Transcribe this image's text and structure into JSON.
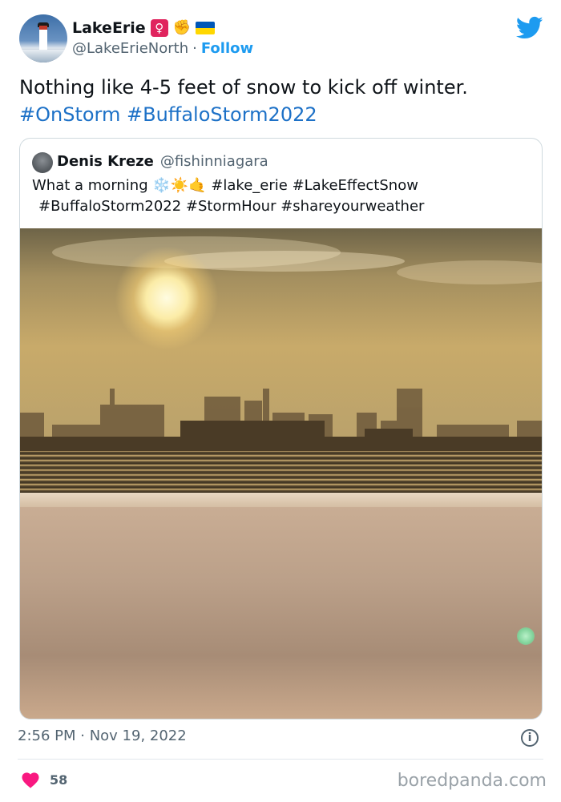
{
  "author": {
    "display_name": "LakeErie",
    "badges": [
      "♀",
      "✊"
    ],
    "handle": "@LakeErieNorth",
    "separator": "·",
    "follow_label": "Follow"
  },
  "tweet": {
    "text": "Nothing like 4-5 feet of snow to kick off winter.",
    "hashtags": [
      "#OnStorm",
      "#BuffaloStorm2022"
    ]
  },
  "quoted": {
    "name": "Denis Kreze",
    "handle": "@fishinniagara",
    "text_line1": "What a morning ❄️☀️🤙  #lake_erie #LakeEffectSnow",
    "text_line2": "#BuffaloStorm2022 #StormHour #shareyourweather"
  },
  "meta": {
    "timestamp": "2:56 PM · Nov 19, 2022",
    "likes": "58",
    "info_glyph": "i"
  },
  "watermark": "boredpanda.com",
  "colors": {
    "accent": "#1d9bf0",
    "hashtag": "#1d71c7",
    "heart": "#f91880",
    "muted": "#536471"
  },
  "icons": {
    "platform": "twitter-bird-icon",
    "like": "heart-icon",
    "info": "info-icon"
  }
}
